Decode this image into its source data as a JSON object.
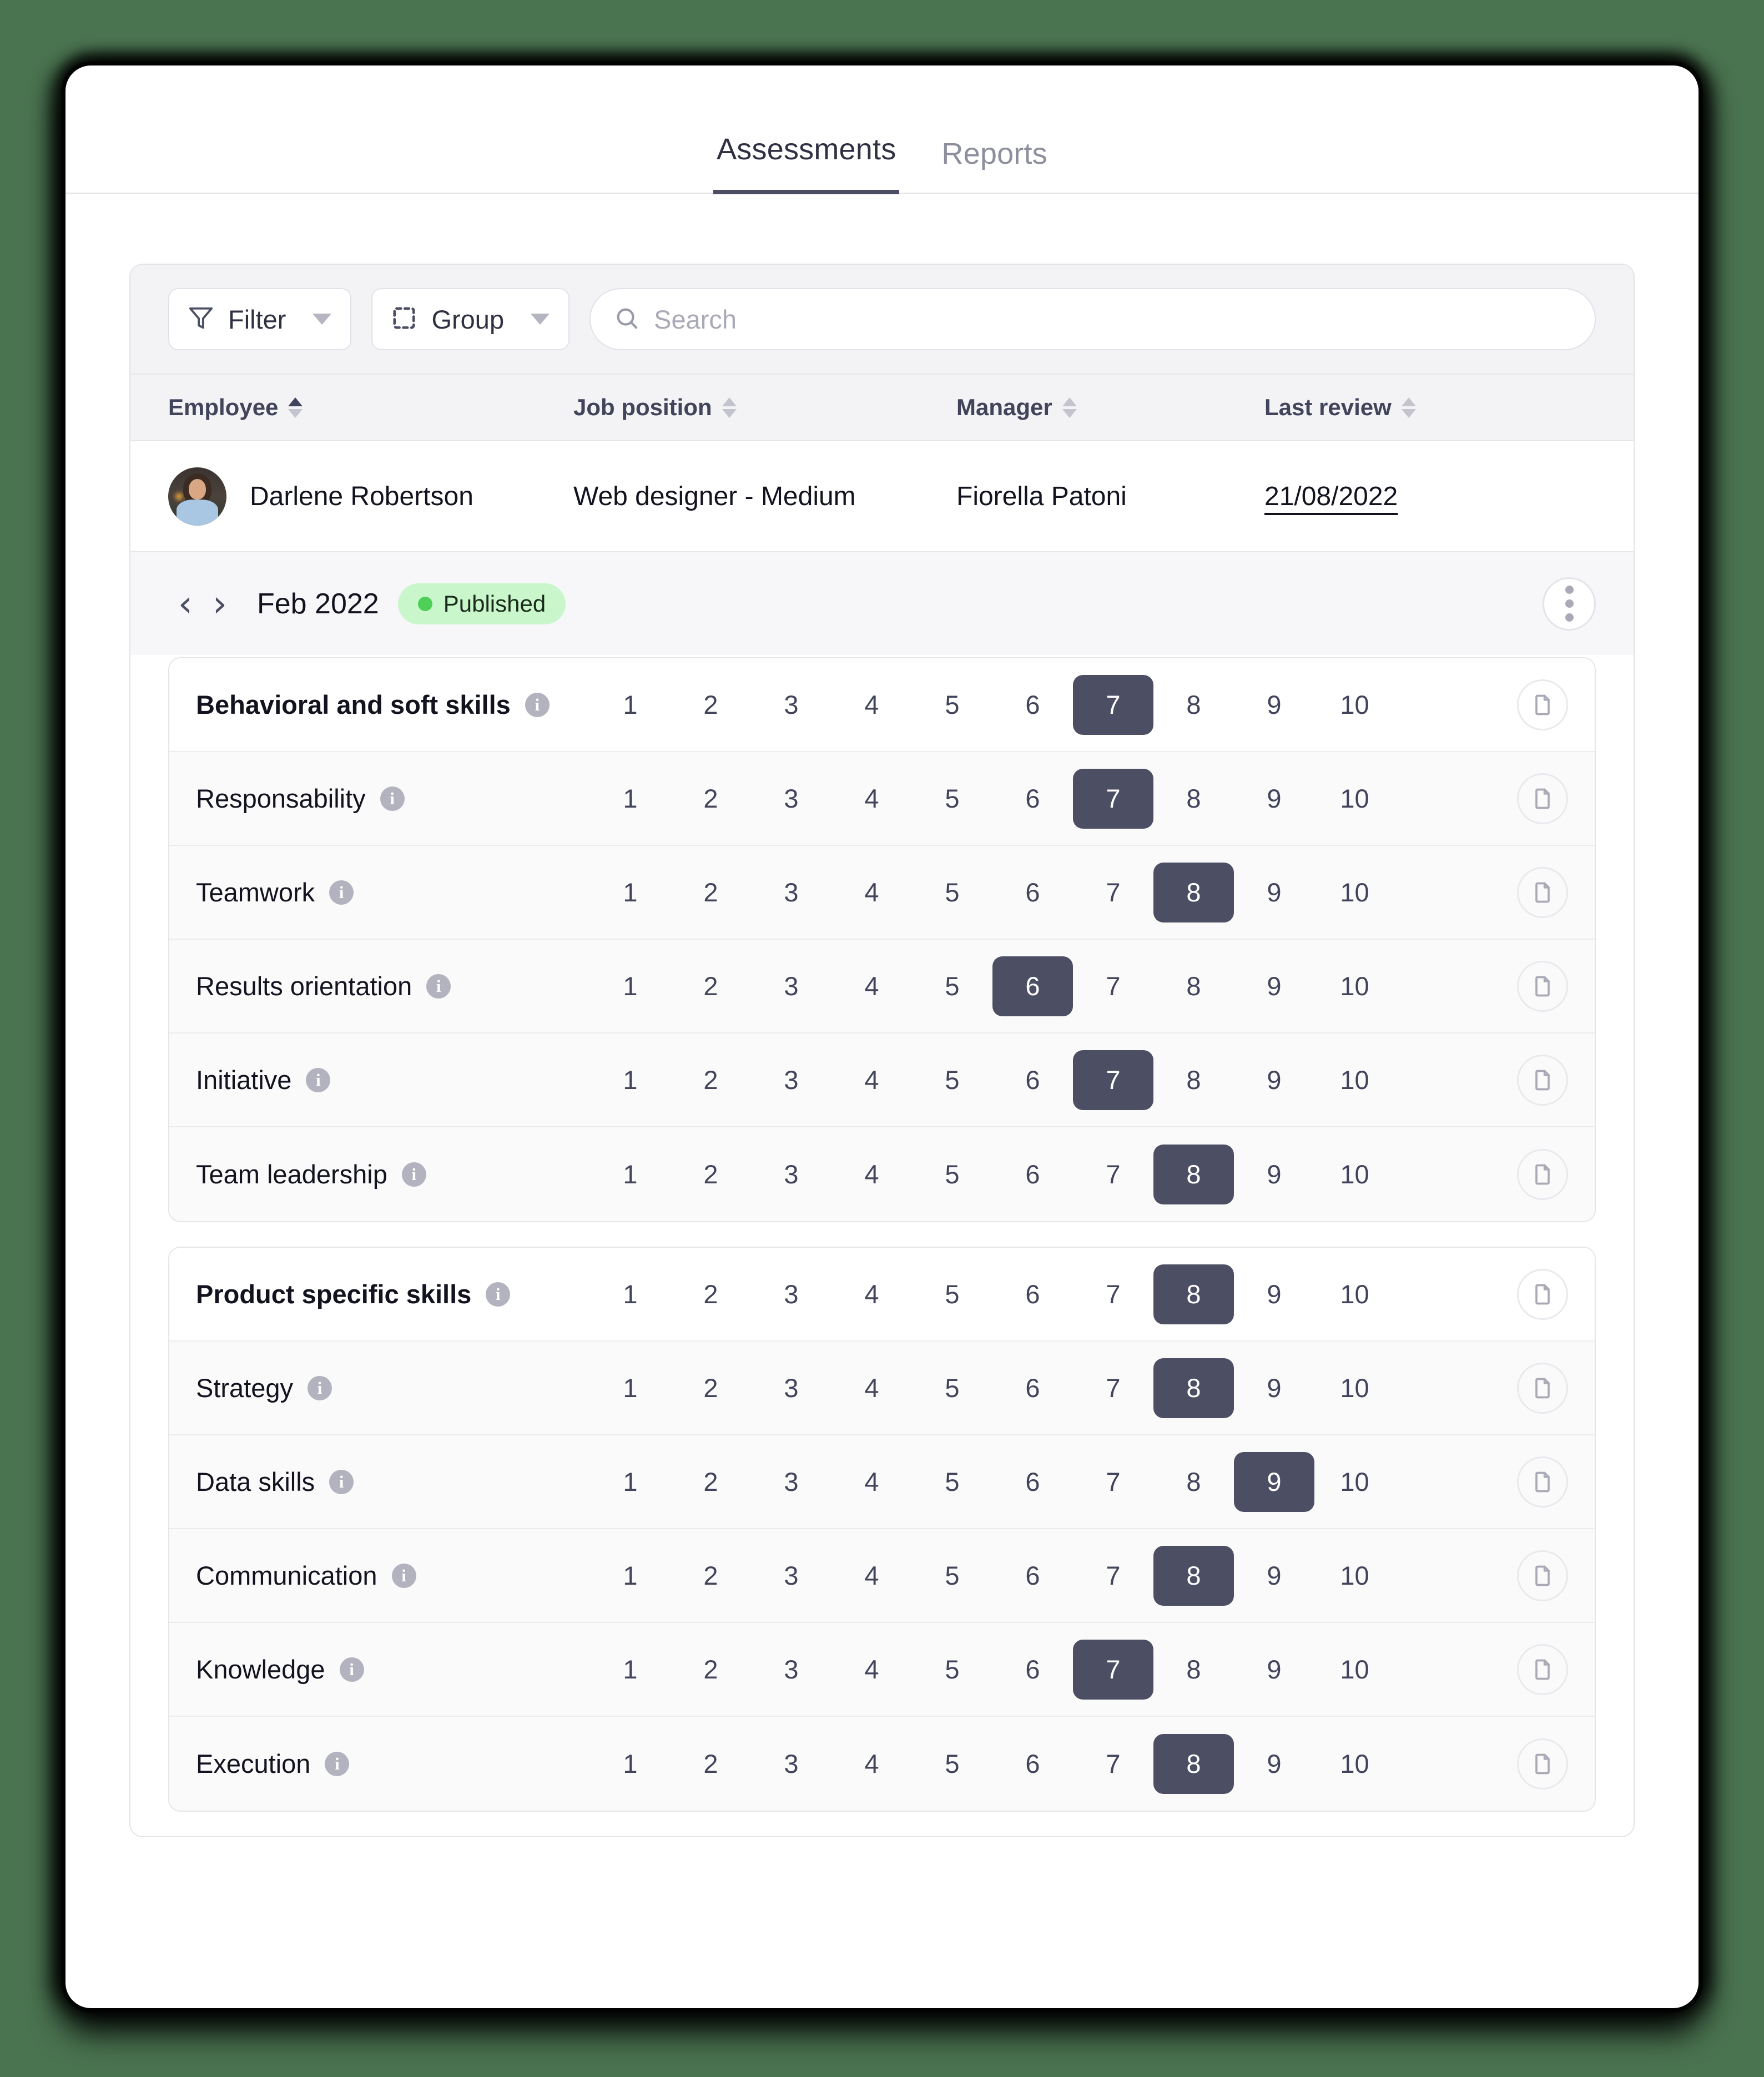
{
  "tabs": [
    {
      "label": "Assessments",
      "active": true
    },
    {
      "label": "Reports",
      "active": false
    }
  ],
  "toolbar": {
    "filter_label": "Filter",
    "group_label": "Group",
    "search_placeholder": "Search",
    "search_value": ""
  },
  "table": {
    "columns": [
      {
        "label": "Employee",
        "sort": "asc",
        "key": "col-employee"
      },
      {
        "label": "Job position",
        "sort": "none",
        "key": "col-position"
      },
      {
        "label": "Manager",
        "sort": "none",
        "key": "col-manager"
      },
      {
        "label": "Last review",
        "sort": "none",
        "key": "col-review"
      }
    ],
    "rows": [
      {
        "employee": "Darlene Robertson",
        "position": "Web designer - Medium",
        "manager": "Fiorella Patoni",
        "last_review": "21/08/2022"
      }
    ]
  },
  "period": {
    "prev_icon": "‹",
    "next_icon": "›",
    "label": "Feb 2022",
    "status": "Published",
    "status_color": "#4ecf58",
    "status_bg": "#c9f7cb",
    "menu_icon": "kebab-menu"
  },
  "scale": {
    "min": 1,
    "max": 10,
    "values": [
      1,
      2,
      3,
      4,
      5,
      6,
      7,
      8,
      9,
      10
    ]
  },
  "accent_selected": "#4c4f63",
  "skill_cards": [
    {
      "card_id": "behavioral-and-soft-skills",
      "rows": [
        {
          "name": "Behavioral and soft skills",
          "score": 7,
          "heading": true
        },
        {
          "name": "Responsability",
          "score": 7,
          "heading": false
        },
        {
          "name": "Teamwork",
          "score": 8,
          "heading": false
        },
        {
          "name": "Results orientation",
          "score": 6,
          "heading": false
        },
        {
          "name": "Initiative",
          "score": 7,
          "heading": false
        },
        {
          "name": "Team leadership",
          "score": 8,
          "heading": false
        }
      ]
    },
    {
      "card_id": "product-specific-skills",
      "rows": [
        {
          "name": "Product specific skills",
          "score": 8,
          "heading": true
        },
        {
          "name": "Strategy",
          "score": 8,
          "heading": false
        },
        {
          "name": "Data skills",
          "score": 9,
          "heading": false
        },
        {
          "name": "Communication",
          "score": 8,
          "heading": false
        },
        {
          "name": "Knowledge",
          "score": 7,
          "heading": false
        },
        {
          "name": "Execution",
          "score": 8,
          "heading": false
        }
      ]
    }
  ]
}
